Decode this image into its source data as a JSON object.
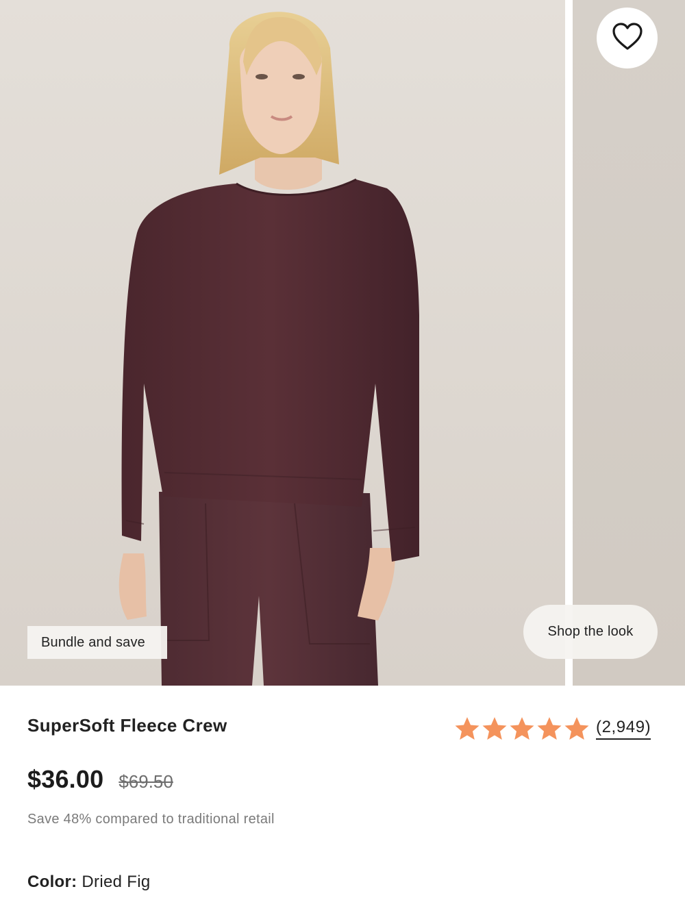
{
  "gallery": {
    "bundle_tag": "Bundle and save",
    "shop_the_look": "Shop the look"
  },
  "product": {
    "title": "SuperSoft Fleece Crew",
    "rating": {
      "stars": 5,
      "review_count": "(2,949)",
      "star_color": "#f4935c"
    },
    "price_now": "$36.00",
    "price_was": "$69.50",
    "savings_text": "Save 48% compared to traditional retail",
    "color_label": "Color:",
    "color_value": "Dried Fig",
    "swatch_color": "#4e2a30"
  },
  "icons": {
    "favorite": "heart-outline-icon",
    "rating_star": "star-icon"
  }
}
